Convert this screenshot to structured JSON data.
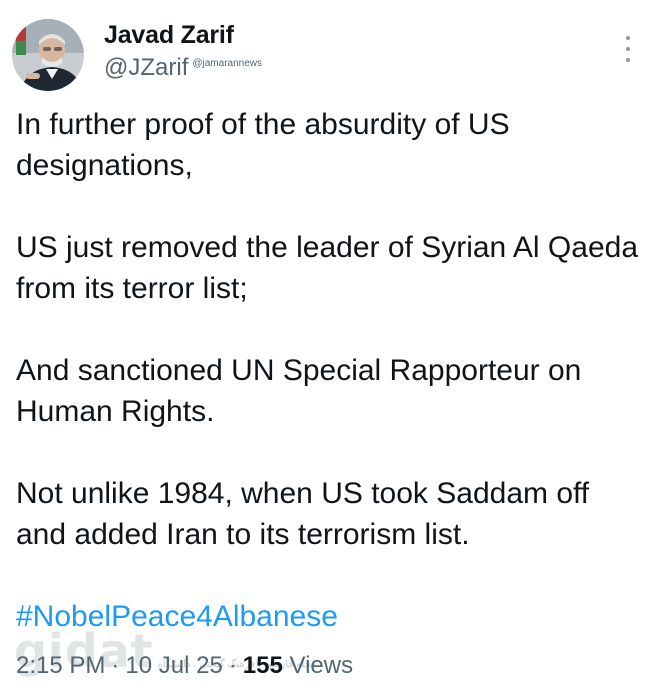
{
  "author": {
    "name": "Javad Zarif",
    "handle": "@JZarif",
    "watermark_handle": "@jamarannews"
  },
  "icons": {
    "more": "more-vertical-icon",
    "avatar": "profile-photo"
  },
  "tweet": {
    "paragraphs": [
      "In further proof of the absurdity of US designations,",
      "US just removed the leader of Syrian Al Qaeda from its terror list;",
      "And sanctioned UN Special Rapporteur on Human Rights.",
      "Not unlike 1984, when US took Saddam off and added Iran to its terrorism list."
    ],
    "hashtag": "#NobelPeace4Albanese",
    "time": "2:15 PM",
    "separator": "·",
    "date": "10 Jul 25",
    "views_count": "155",
    "views_label": "Views"
  },
  "watermark": {
    "logo": "gidat",
    "tagline": "مجله فارسی ، فرهنگ گیجتی ، دانشگاه"
  },
  "colors": {
    "text": "#0f1419",
    "secondary": "#536471",
    "link": "#1d9bf0"
  }
}
